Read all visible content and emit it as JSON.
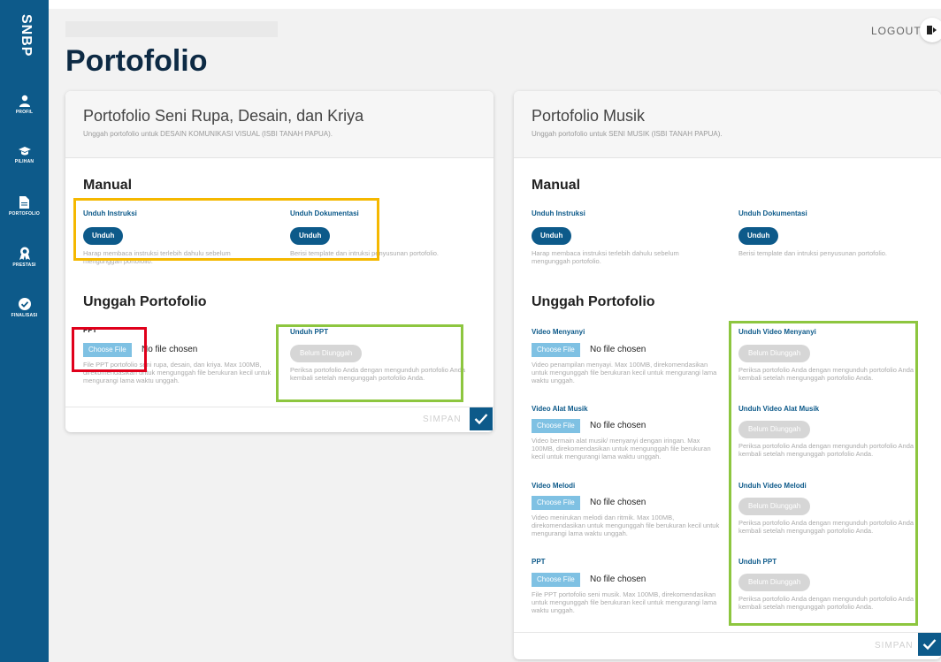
{
  "app": {
    "brand": "SNBP",
    "title": "Portofolio",
    "logout_label": "LOGOUT"
  },
  "sidebar": {
    "items": [
      {
        "label": "PROFIL",
        "icon": "user-icon"
      },
      {
        "label": "PILIHAN",
        "icon": "graduation-cap-icon"
      },
      {
        "label": "PORTOFOLIO",
        "icon": "document-icon"
      },
      {
        "label": "PRESTASI",
        "icon": "award-icon"
      },
      {
        "label": "FINALISASI",
        "icon": "check-circle-icon"
      }
    ]
  },
  "cards": {
    "seni": {
      "title": "Portofolio Seni Rupa, Desain, dan Kriya",
      "subtitle": "Unggah portofolio untuk DESAIN KOMUNIKASI VISUAL (ISBI TANAH PAPUA).",
      "manual_heading": "Manual",
      "instruksi_label": "Unduh Instruksi",
      "instruksi_button": "Unduh",
      "instruksi_hint": "Harap membaca instruksi terlebih dahulu sebelum mengunggah portofolio.",
      "dokumentasi_label": "Unduh Dokumentasi",
      "dokumentasi_button": "Unduh",
      "dokumentasi_hint": "Berisi template dan intruksi penyusunan portofolio.",
      "upload_heading": "Unggah Portofolio",
      "ppt_label": "PPT",
      "choose_file": "Choose File",
      "no_file": "No file chosen",
      "ppt_hint": "File PPT portofolio seni rupa, desain, dan kriya. Max 100MB, direkomendasikan untuk mengunggah file berukuran kecil untuk mengurangi lama waktu unggah.",
      "unduh_ppt_label": "Unduh PPT",
      "belum_button": "Belum Diunggah",
      "unduh_ppt_hint": "Periksa portofolio Anda dengan mengunduh portofolio Anda kembali setelah mengunggah portofolio Anda.",
      "simpan": "SIMPAN"
    },
    "musik": {
      "title": "Portofolio Musik",
      "subtitle": "Unggah portofolio untuk SENI MUSIK (ISBI TANAH PAPUA).",
      "manual_heading": "Manual",
      "instruksi_label": "Unduh Instruksi",
      "instruksi_button": "Unduh",
      "instruksi_hint": "Harap membaca instruksi terlebih dahulu sebelum mengunggah portofolio.",
      "dokumentasi_label": "Unduh Dokumentasi",
      "dokumentasi_button": "Unduh",
      "dokumentasi_hint": "Berisi template dan intruksi penyusunan portofolio.",
      "upload_heading": "Unggah Portofolio",
      "choose_file": "Choose File",
      "no_file": "No file chosen",
      "belum_button": "Belum Diunggah",
      "rows": [
        {
          "label": "Video Menyanyi",
          "hint": "Video penampilan menyayi. Max 100MB, direkomendasikan untuk mengunggah file berukuran kecil untuk mengurangi lama waktu unggah.",
          "download_label": "Unduh Video Menyanyi",
          "download_hint": "Periksa portofolio Anda dengan mengunduh portofolio Anda kembali setelah mengunggah portofolio Anda."
        },
        {
          "label": "Video Alat Musik",
          "hint": "Video bermain alat musik/ menyanyi dengan iringan. Max 100MB, direkomendasikan untuk mengunggah file berukuran kecil untuk mengurangi lama waktu unggah.",
          "download_label": "Unduh Video Alat Musik",
          "download_hint": "Periksa portofolio Anda dengan mengunduh portofolio Anda kembali setelah mengunggah portofolio Anda."
        },
        {
          "label": "Video Melodi",
          "hint": "Video menirukan melodi dan ritmik. Max 100MB, direkomendasikan untuk mengunggah file berukuran kecil untuk mengurangi lama waktu unggah.",
          "download_label": "Unduh Video Melodi",
          "download_hint": "Periksa portofolio Anda dengan mengunduh portofolio Anda kembali setelah mengunggah portofolio Anda."
        },
        {
          "label": "PPT",
          "hint": "File PPT portofolio seni musik. Max 100MB, direkomendasikan untuk mengunggah file berukuran kecil untuk mengurangi lama waktu unggah.",
          "download_label": "Unduh PPT",
          "download_hint": "Periksa portofolio Anda dengan mengunduh portofolio Anda kembali setelah mengunggah portofolio Anda."
        }
      ],
      "simpan": "SIMPAN"
    }
  },
  "colors": {
    "brand": "#0d5a8a",
    "highlight_yellow": "#f5b800",
    "highlight_green": "#8dc63f",
    "highlight_red": "#e0001b"
  }
}
